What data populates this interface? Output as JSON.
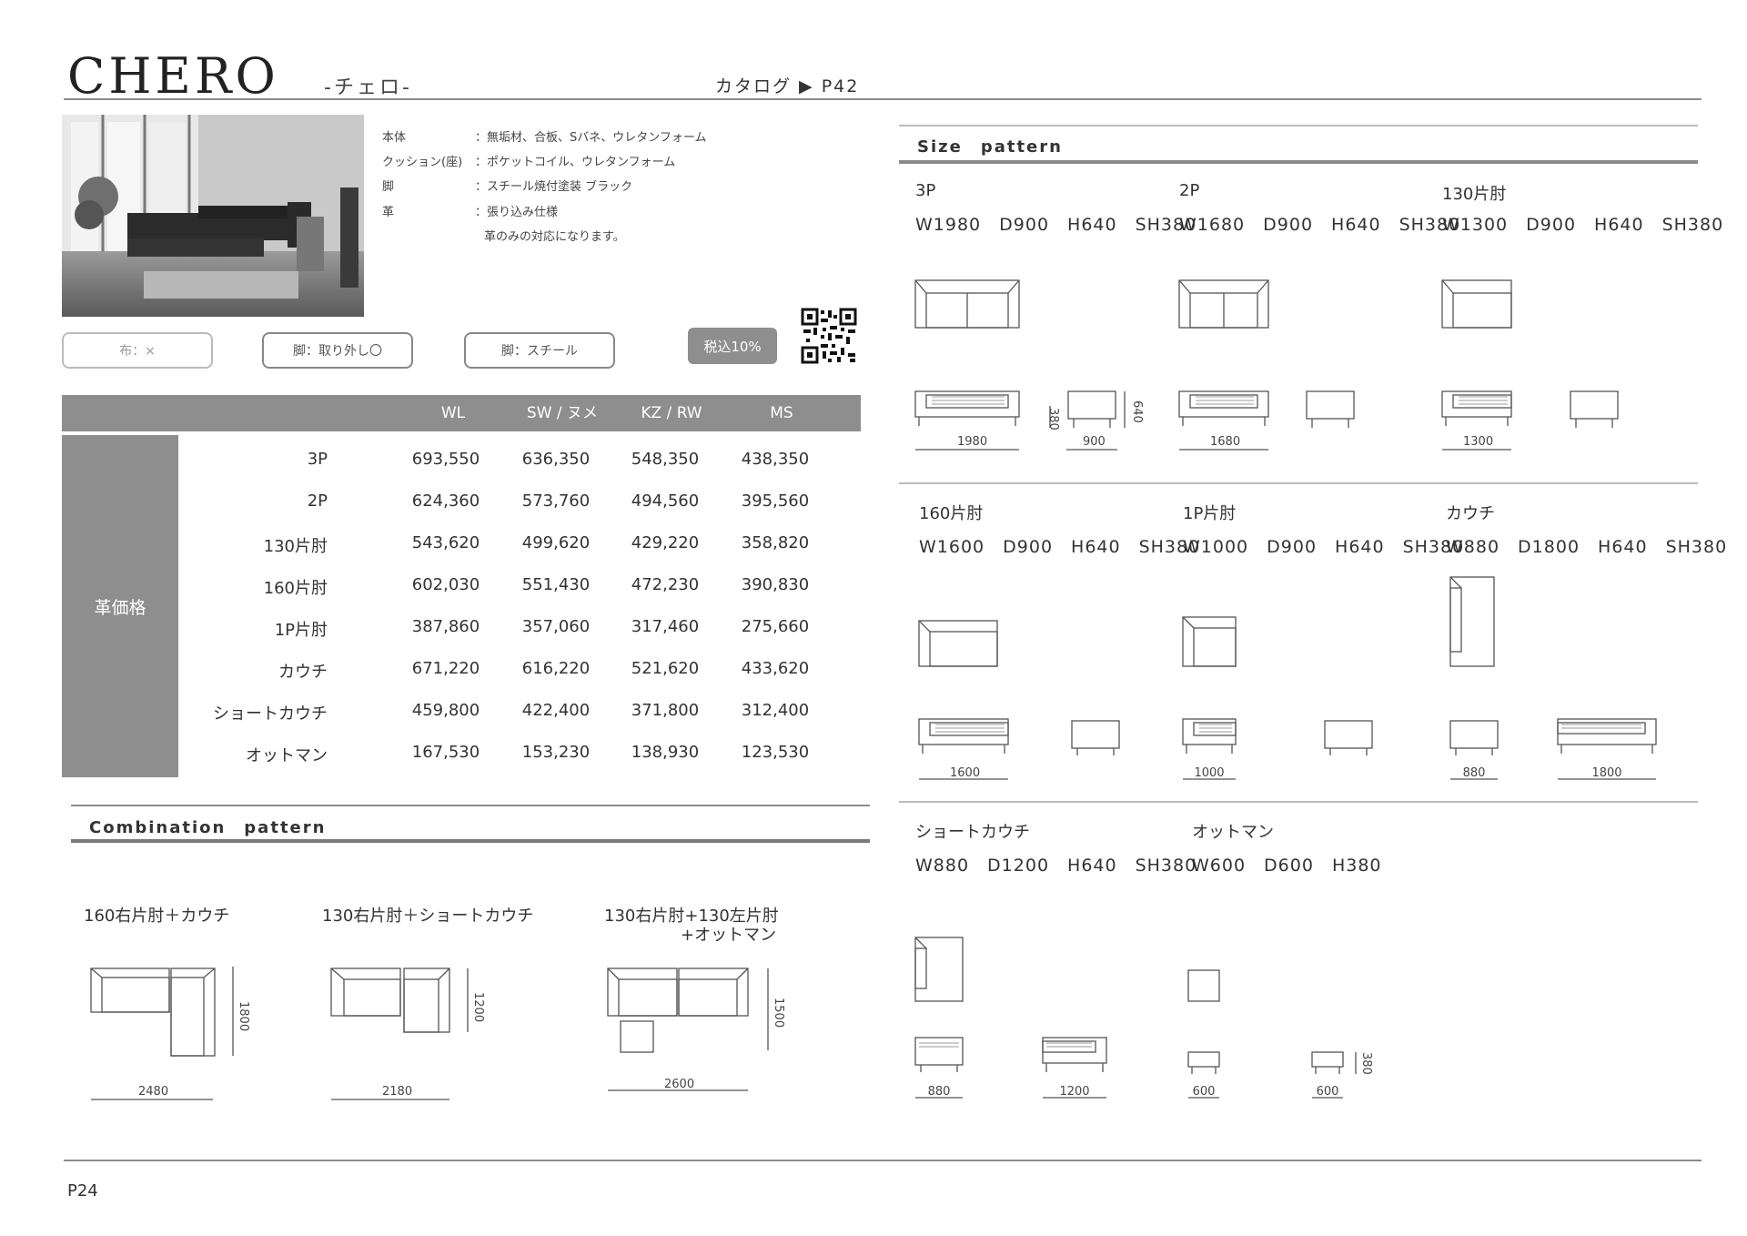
{
  "header": {
    "title": "CHERO",
    "kana": "-チェロ-",
    "catalog_ref": "カタログ ▶ P42"
  },
  "specs": [
    {
      "key": "本体",
      "value": "：無垢材、合板、Sバネ、ウレタンフォーム"
    },
    {
      "key": "クッション(座)",
      "value": "：ポケットコイル、ウレタンフォーム"
    },
    {
      "key": "脚",
      "value": "：スチール焼付塗装 ブラック"
    },
    {
      "key": "革",
      "value": "：張り込み仕様"
    },
    {
      "key": "",
      "value": "革のみの対応になります。"
    }
  ],
  "badges": {
    "fabric": "布：×",
    "leg_removable": "脚：取り外し〇",
    "leg_material": "脚：スチール",
    "tax": "税込10%"
  },
  "price_table": {
    "side_label": "革価格",
    "columns": [
      "WL",
      "SW / ヌメ",
      "KZ / RW",
      "MS"
    ],
    "rows": [
      {
        "name": "3P",
        "values": [
          "693,550",
          "636,350",
          "548,350",
          "438,350"
        ]
      },
      {
        "name": "2P",
        "values": [
          "624,360",
          "573,760",
          "494,560",
          "395,560"
        ]
      },
      {
        "name": "130片肘",
        "values": [
          "543,620",
          "499,620",
          "429,220",
          "358,820"
        ]
      },
      {
        "name": "160片肘",
        "values": [
          "602,030",
          "551,430",
          "472,230",
          "390,830"
        ]
      },
      {
        "name": "1P片肘",
        "values": [
          "387,860",
          "357,060",
          "317,460",
          "275,660"
        ]
      },
      {
        "name": "カウチ",
        "values": [
          "671,220",
          "616,220",
          "521,620",
          "433,620"
        ]
      },
      {
        "name": "ショートカウチ",
        "values": [
          "459,800",
          "422,400",
          "371,800",
          "312,400"
        ]
      },
      {
        "name": "オットマン",
        "values": [
          "167,530",
          "153,230",
          "138,930",
          "123,530"
        ]
      }
    ]
  },
  "combination": {
    "title": "Combination　pattern",
    "items": [
      {
        "label": "160右片肘＋カウチ",
        "width": "2480",
        "depth": "1800"
      },
      {
        "label": "130右片肘＋ショートカウチ",
        "width": "2180",
        "depth": "1200"
      },
      {
        "label": "130右片肘+130左片肘",
        "label2": "+オットマン",
        "width": "2600",
        "depth": "1500"
      }
    ]
  },
  "size": {
    "title": "Size　pattern",
    "items": [
      {
        "label": "3P",
        "dims": "W1980　D900　H640　SH380",
        "front": "1980",
        "side": "900",
        "seat_h": "380",
        "h": "640"
      },
      {
        "label": "2P",
        "dims": "W1680　D900　H640　SH380",
        "front": "1680"
      },
      {
        "label": "130片肘",
        "dims": "W1300　D900　H640　SH380",
        "front": "1300"
      },
      {
        "label": "160片肘",
        "dims": "W1600　D900　H640　SH380",
        "front": "1600"
      },
      {
        "label": "1P片肘",
        "dims": "W1000　D900　H640　SH380",
        "front": "1000"
      },
      {
        "label": "カウチ",
        "dims": "W880　D1800　H640　SH380",
        "front": "880",
        "side": "1800"
      },
      {
        "label": "ショートカウチ",
        "dims": "W880　D1200　H640　SH380",
        "front": "880",
        "side": "1200"
      },
      {
        "label": "オットマン",
        "dims": "W600　D600　H380",
        "front": "600",
        "side": "600",
        "h": "380"
      }
    ]
  },
  "footer": {
    "page": "P24"
  }
}
